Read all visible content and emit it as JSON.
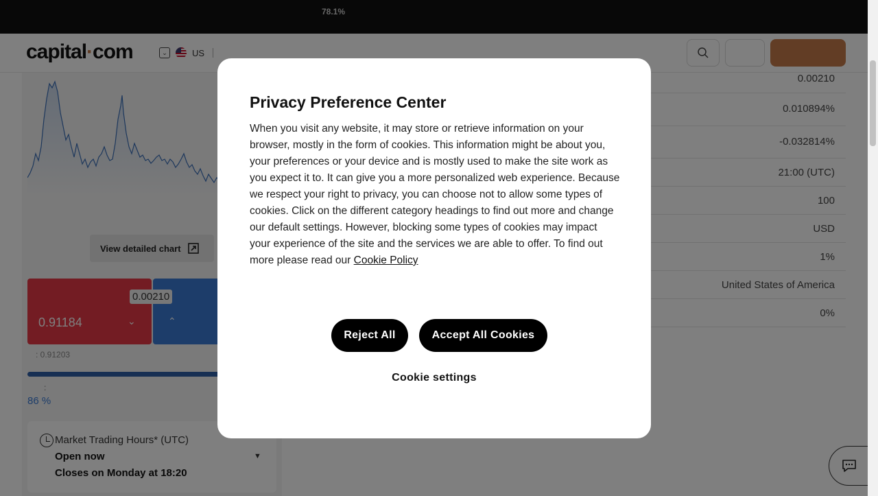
{
  "top_bar": {
    "percent": "78.1%"
  },
  "header": {
    "logo": {
      "text_a": "capital",
      "dot": "·",
      "text_b": "com"
    },
    "region": "US",
    "icons": [
      "checkbox-icon",
      "us-flag-icon",
      "search-icon"
    ]
  },
  "left_panel": {
    "view_chart_label": "View detailed chart",
    "sell_price": "0.91184",
    "spread": "0.00210",
    "low_label": ": 0.91203",
    "sentiment_colon": ":",
    "sentiment_percent": "86 %",
    "sentiment_value": 0.86,
    "market_hours": {
      "title": "Market Trading Hours* (UTC)",
      "status": "Open now",
      "closes": "Closes on Monday at 18:20"
    }
  },
  "table_values": [
    "0.00210",
    "0.010894%",
    "-0.032814%",
    "21:00 (UTC)",
    "100",
    "USD",
    "1%",
    "United States of America",
    "0%"
  ],
  "modal": {
    "title": "Privacy Preference Center",
    "description": "When you visit any website, it may store or retrieve information on your browser, mostly in the form of cookies. This information might be about you, your preferences or your device and is mostly used to make the site work as you expect it to. It can give you a more personalized web experience. Because we respect your right to privacy, you can choose not to allow some types of cookies. Click on the different category headings to find out more and change our default settings. However, blocking some types of cookies may impact your experience of the site and the services we are able to offer. To find out more please read our",
    "policy_link": "Cookie Policy",
    "reject_label": "Reject All",
    "accept_label": "Accept All Cookies",
    "settings_label": "Cookie settings"
  },
  "colors": {
    "brand": "#c47b4b",
    "sell": "#e63946",
    "buy": "#3a7bd5",
    "overlay": "rgba(0,0,0,0.5)"
  }
}
